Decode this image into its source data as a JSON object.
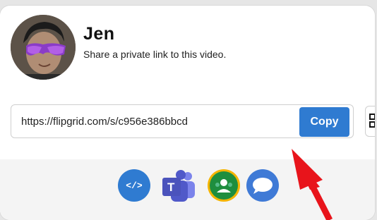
{
  "user": {
    "name": "Jen"
  },
  "share": {
    "subtitle": "Share a private link to this video.",
    "link": "https://flipgrid.com/s/c956e386bbcd",
    "copy_label": "Copy"
  },
  "share_targets": [
    {
      "icon": "embed-code-icon",
      "label": "</>",
      "color": "#2f7bd1"
    },
    {
      "icon": "microsoft-teams-icon",
      "label": "T",
      "color": "#5059c9"
    },
    {
      "icon": "google-classroom-icon",
      "color": "#1e8e3e"
    },
    {
      "icon": "remind-icon",
      "color": "#3f7ad6"
    }
  ],
  "colors": {
    "accent": "#2f7bd1",
    "arrow": "#e8141b"
  }
}
